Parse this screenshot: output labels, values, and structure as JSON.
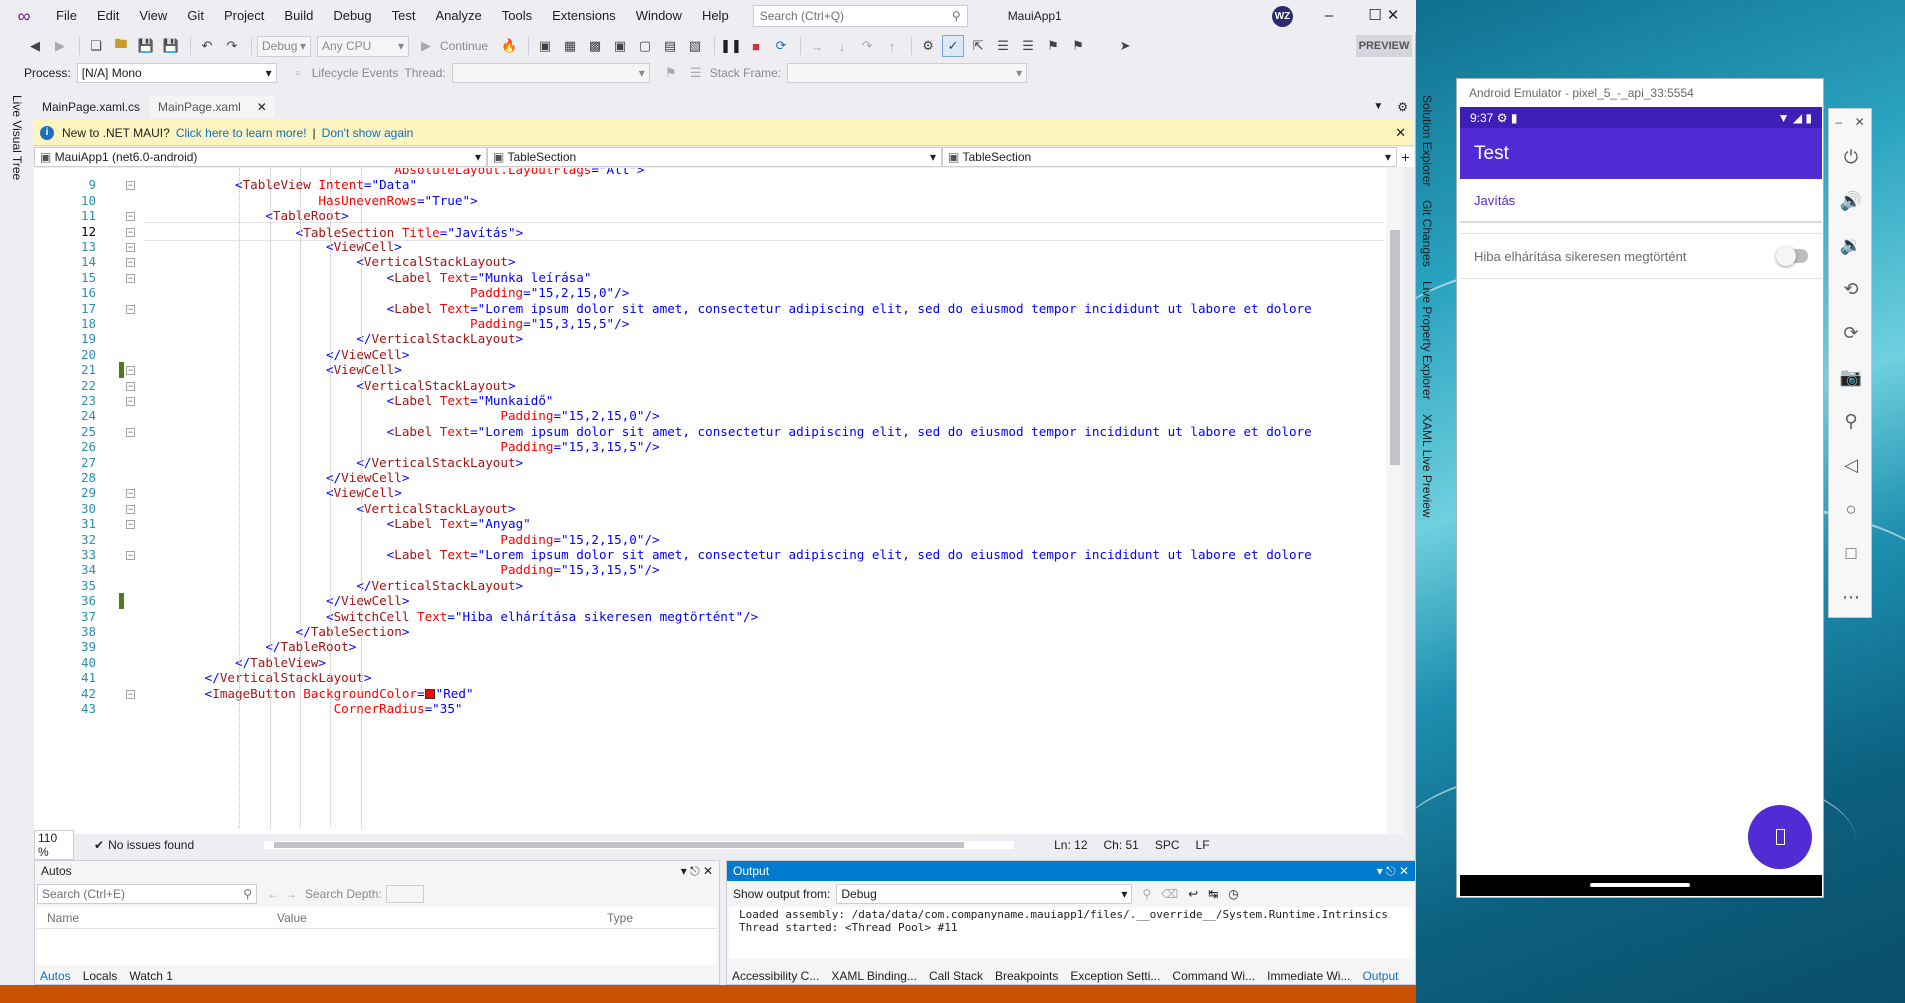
{
  "vs": {
    "menu": [
      "File",
      "Edit",
      "View",
      "Git",
      "Project",
      "Build",
      "Debug",
      "Test",
      "Analyze",
      "Tools",
      "Extensions",
      "Window",
      "Help"
    ],
    "search_placeholder": "Search (Ctrl+Q)",
    "solution_name": "MauiApp1",
    "avatar": "WZ",
    "toolbar": {
      "config": "Debug",
      "platform": "Any CPU",
      "continue": "Continue",
      "preview": "PREVIEW"
    },
    "toolbar2": {
      "process_label": "Process:",
      "process_value": "[N/A] Mono",
      "lifecycle": "Lifecycle Events",
      "thread_label": "Thread:",
      "stack_label": "Stack Frame:"
    },
    "left_rail": "Live Visual Tree",
    "tabs": [
      {
        "label": "MainPage.xaml.cs",
        "active": false
      },
      {
        "label": "MainPage.xaml",
        "active": true
      }
    ],
    "info_bar": {
      "text": "New to .NET MAUI?",
      "link1": "Click here to learn more!",
      "sep": "|",
      "link2": "Don't show again"
    },
    "nav": {
      "project": "MauiApp1 (net6.0-android)",
      "scope": "TableSection",
      "member": "TableSection"
    },
    "right_rail": [
      "Solution Explorer",
      "Git Changes",
      "Live Property Explorer",
      "XAML Live Preview"
    ],
    "editor_status": {
      "zoom": "110 %",
      "issues": "No issues found",
      "line": "Ln: 12",
      "col": "Ch: 51",
      "spc": "SPC",
      "lf": "LF"
    },
    "autos": {
      "title": "Autos",
      "search_placeholder": "Search (Ctrl+E)",
      "search_depth": "Search Depth:",
      "cols": [
        "Name",
        "Value",
        "Type"
      ],
      "tabs": [
        "Autos",
        "Locals",
        "Watch 1"
      ]
    },
    "output": {
      "title": "Output",
      "show_from": "Show output from:",
      "source": "Debug",
      "lines": [
        "Loaded assembly: /data/data/com.companyname.mauiapp1/files/.__override__/System.Runtime.Intrinsics",
        "Thread started: <Thread Pool> #11"
      ],
      "tabs": [
        "Accessibility C...",
        "XAML Binding...",
        "Call Stack",
        "Breakpoints",
        "Exception Setti...",
        "Command Wi...",
        "Immediate Wi...",
        "Output"
      ]
    }
  },
  "code": {
    "lines": [
      {
        "n": "",
        "indent": 33,
        "html": [
          [
            "a",
            "AbsoluteLayout.LayoutFlags"
          ],
          [
            "p",
            "=\""
          ],
          [
            "v",
            "All"
          ],
          [
            "p",
            "\">"
          ]
        ]
      },
      {
        "n": "9",
        "indent": 12,
        "html": [
          [
            "p",
            "<"
          ],
          [
            "t",
            "TableView"
          ],
          [
            "a",
            " Intent"
          ],
          [
            "p",
            "=\""
          ],
          [
            "v",
            "Data"
          ],
          [
            "p",
            "\""
          ]
        ]
      },
      {
        "n": "10",
        "indent": 23,
        "html": [
          [
            "a",
            "HasUnevenRows"
          ],
          [
            "p",
            "=\""
          ],
          [
            "v",
            "True"
          ],
          [
            "p",
            "\">"
          ]
        ]
      },
      {
        "n": "11",
        "indent": 16,
        "html": [
          [
            "p",
            "<"
          ],
          [
            "t",
            "TableRoot"
          ],
          [
            "p",
            ">"
          ]
        ]
      },
      {
        "n": "12",
        "indent": 20,
        "html": [
          [
            "p",
            "<"
          ],
          [
            "t",
            "TableSection"
          ],
          [
            "a",
            " Title"
          ],
          [
            "p",
            "=\""
          ],
          [
            "v",
            "Javítás"
          ],
          [
            "p",
            "\">"
          ]
        ]
      },
      {
        "n": "13",
        "indent": 24,
        "html": [
          [
            "p",
            "<"
          ],
          [
            "t",
            "ViewCell"
          ],
          [
            "p",
            ">"
          ]
        ]
      },
      {
        "n": "14",
        "indent": 28,
        "html": [
          [
            "p",
            "<"
          ],
          [
            "t",
            "VerticalStackLayout"
          ],
          [
            "p",
            ">"
          ]
        ]
      },
      {
        "n": "15",
        "indent": 32,
        "html": [
          [
            "p",
            "<"
          ],
          [
            "t",
            "Label"
          ],
          [
            "a",
            " Text"
          ],
          [
            "p",
            "=\""
          ],
          [
            "v",
            "Munka leírása"
          ],
          [
            "p",
            "\""
          ]
        ]
      },
      {
        "n": "16",
        "indent": 43,
        "html": [
          [
            "a",
            "Padding"
          ],
          [
            "p",
            "=\""
          ],
          [
            "v",
            "15,2,15,0"
          ],
          [
            "p",
            "\"/>"
          ]
        ]
      },
      {
        "n": "17",
        "indent": 32,
        "html": [
          [
            "p",
            "<"
          ],
          [
            "t",
            "Label"
          ],
          [
            "a",
            " Text"
          ],
          [
            "p",
            "=\""
          ],
          [
            "v",
            "Lorem ipsum dolor sit amet, consectetur adipiscing elit, sed do eiusmod tempor incididunt ut labore et dolore"
          ]
        ]
      },
      {
        "n": "18",
        "indent": 43,
        "html": [
          [
            "a",
            "Padding"
          ],
          [
            "p",
            "=\""
          ],
          [
            "v",
            "15,3,15,5"
          ],
          [
            "p",
            "\"/>"
          ]
        ]
      },
      {
        "n": "19",
        "indent": 28,
        "html": [
          [
            "p",
            "</"
          ],
          [
            "t",
            "VerticalStackLayout"
          ],
          [
            "p",
            ">"
          ]
        ]
      },
      {
        "n": "20",
        "indent": 24,
        "html": [
          [
            "p",
            "</"
          ],
          [
            "t",
            "ViewCell"
          ],
          [
            "p",
            ">"
          ]
        ]
      },
      {
        "n": "21",
        "indent": 24,
        "html": [
          [
            "p",
            "<"
          ],
          [
            "t",
            "ViewCell"
          ],
          [
            "p",
            ">"
          ]
        ]
      },
      {
        "n": "22",
        "indent": 28,
        "html": [
          [
            "p",
            "<"
          ],
          [
            "t",
            "VerticalStackLayout"
          ],
          [
            "p",
            ">"
          ]
        ]
      },
      {
        "n": "23",
        "indent": 32,
        "html": [
          [
            "p",
            "<"
          ],
          [
            "t",
            "Label"
          ],
          [
            "a",
            " Text"
          ],
          [
            "p",
            "=\""
          ],
          [
            "v",
            "Munkaidő"
          ],
          [
            "p",
            "\""
          ]
        ]
      },
      {
        "n": "24",
        "indent": 47,
        "html": [
          [
            "a",
            "Padding"
          ],
          [
            "p",
            "=\""
          ],
          [
            "v",
            "15,2,15,0"
          ],
          [
            "p",
            "\"/>"
          ]
        ]
      },
      {
        "n": "25",
        "indent": 32,
        "html": [
          [
            "p",
            "<"
          ],
          [
            "t",
            "Label"
          ],
          [
            "a",
            " Text"
          ],
          [
            "p",
            "=\""
          ],
          [
            "v",
            "Lorem ipsum dolor sit amet, consectetur adipiscing elit, sed do eiusmod tempor incididunt ut labore et dolore"
          ]
        ]
      },
      {
        "n": "26",
        "indent": 47,
        "html": [
          [
            "a",
            "Padding"
          ],
          [
            "p",
            "=\""
          ],
          [
            "v",
            "15,3,15,5"
          ],
          [
            "p",
            "\"/>"
          ]
        ]
      },
      {
        "n": "27",
        "indent": 28,
        "html": [
          [
            "p",
            "</"
          ],
          [
            "t",
            "VerticalStackLayout"
          ],
          [
            "p",
            ">"
          ]
        ]
      },
      {
        "n": "28",
        "indent": 24,
        "html": [
          [
            "p",
            "</"
          ],
          [
            "t",
            "ViewCell"
          ],
          [
            "p",
            ">"
          ]
        ]
      },
      {
        "n": "29",
        "indent": 24,
        "html": [
          [
            "p",
            "<"
          ],
          [
            "t",
            "ViewCell"
          ],
          [
            "p",
            ">"
          ]
        ]
      },
      {
        "n": "30",
        "indent": 28,
        "html": [
          [
            "p",
            "<"
          ],
          [
            "t",
            "VerticalStackLayout"
          ],
          [
            "p",
            ">"
          ]
        ]
      },
      {
        "n": "31",
        "indent": 32,
        "html": [
          [
            "p",
            "<"
          ],
          [
            "t",
            "Label"
          ],
          [
            "a",
            " Text"
          ],
          [
            "p",
            "=\""
          ],
          [
            "v",
            "Anyag"
          ],
          [
            "p",
            "\""
          ]
        ]
      },
      {
        "n": "32",
        "indent": 47,
        "html": [
          [
            "a",
            "Padding"
          ],
          [
            "p",
            "=\""
          ],
          [
            "v",
            "15,2,15,0"
          ],
          [
            "p",
            "\"/>"
          ]
        ]
      },
      {
        "n": "33",
        "indent": 32,
        "html": [
          [
            "p",
            "<"
          ],
          [
            "t",
            "Label"
          ],
          [
            "a",
            " Text"
          ],
          [
            "p",
            "=\""
          ],
          [
            "v",
            "Lorem ipsum dolor sit amet, consectetur adipiscing elit, sed do eiusmod tempor incididunt ut labore et dolore"
          ]
        ]
      },
      {
        "n": "34",
        "indent": 47,
        "html": [
          [
            "a",
            "Padding"
          ],
          [
            "p",
            "=\""
          ],
          [
            "v",
            "15,3,15,5"
          ],
          [
            "p",
            "\"/>"
          ]
        ]
      },
      {
        "n": "35",
        "indent": 28,
        "html": [
          [
            "p",
            "</"
          ],
          [
            "t",
            "VerticalStackLayout"
          ],
          [
            "p",
            ">"
          ]
        ]
      },
      {
        "n": "36",
        "indent": 24,
        "html": [
          [
            "p",
            "</"
          ],
          [
            "t",
            "ViewCell"
          ],
          [
            "p",
            ">"
          ]
        ]
      },
      {
        "n": "37",
        "indent": 24,
        "html": [
          [
            "p",
            "<"
          ],
          [
            "t",
            "SwitchCell"
          ],
          [
            "a",
            " Text"
          ],
          [
            "p",
            "=\""
          ],
          [
            "v",
            "Hiba elhárítása sikeresen megtörtént"
          ],
          [
            "p",
            "\"/>"
          ]
        ]
      },
      {
        "n": "38",
        "indent": 20,
        "html": [
          [
            "p",
            "</"
          ],
          [
            "t",
            "TableSection"
          ],
          [
            "p",
            ">"
          ]
        ]
      },
      {
        "n": "39",
        "indent": 16,
        "html": [
          [
            "p",
            "</"
          ],
          [
            "t",
            "TableRoot"
          ],
          [
            "p",
            ">"
          ]
        ]
      },
      {
        "n": "40",
        "indent": 12,
        "html": [
          [
            "p",
            "</"
          ],
          [
            "t",
            "TableView"
          ],
          [
            "p",
            ">"
          ]
        ]
      },
      {
        "n": "41",
        "indent": 8,
        "html": [
          [
            "p",
            "</"
          ],
          [
            "t",
            "VerticalStackLayout"
          ],
          [
            "p",
            ">"
          ]
        ]
      },
      {
        "n": "42",
        "indent": 8,
        "html": [
          [
            "p",
            "<"
          ],
          [
            "t",
            "ImageButton"
          ],
          [
            "a",
            " BackgroundColor"
          ],
          [
            "p",
            "="
          ],
          [
            "swatch",
            ""
          ],
          [
            "p",
            "\""
          ],
          [
            "v",
            "Red"
          ],
          [
            "p",
            "\""
          ]
        ]
      },
      {
        "n": "43",
        "indent": 25,
        "html": [
          [
            "a",
            "CornerRadius"
          ],
          [
            "p",
            "=\""
          ],
          [
            "v",
            "35"
          ],
          [
            "p",
            "\""
          ]
        ]
      }
    ],
    "current_line": "12",
    "changed_lines": [
      "21",
      "36"
    ],
    "fold_lines": [
      "9",
      "11",
      "12",
      "13",
      "14",
      "15",
      "17",
      "21",
      "22",
      "23",
      "25",
      "29",
      "30",
      "31",
      "33",
      "42"
    ]
  },
  "emulator": {
    "title": "Android Emulator - pixel_5_-_api_33:5554",
    "time": "9:37",
    "app_title": "Test",
    "section_title": "Javítás",
    "switch_label": "Hiba elhárítása sikeresen megtörtént",
    "switch_on": false,
    "fab_icon": "placeholder-glyph-icon",
    "toolbar_icons": [
      "power-icon",
      "volume-up-icon",
      "volume-down-icon",
      "rotate-left-icon",
      "rotate-right-icon",
      "camera-icon",
      "zoom-icon",
      "back-icon",
      "home-icon",
      "overview-icon",
      "more-icon"
    ]
  },
  "colors": {
    "maui_purple": "#512bd4",
    "vs_accent": "#007acc",
    "status_bar": "#ca5100",
    "info_bar": "#fdf4bf"
  }
}
